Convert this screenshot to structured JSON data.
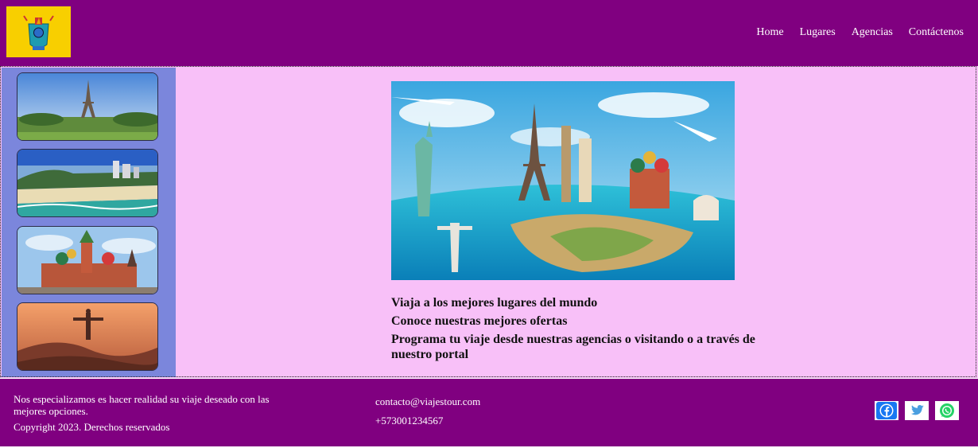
{
  "nav": {
    "items": [
      "Home",
      "Lugares",
      "Agencias",
      "Contáctenos"
    ]
  },
  "sidebar": {
    "thumbnails": [
      "eiffel-tower",
      "beach-city",
      "kremlin-cathedral",
      "christ-the-redeemer"
    ]
  },
  "main": {
    "lines": [
      "Viaja a los mejores lugares del mundo",
      "Conoce nuestras mejores ofertas",
      "Programa tu viaje desde nuestras agencias o visitando o a través de nuestro portal"
    ]
  },
  "footer": {
    "description": "Nos especializamos es hacer realidad su viaje deseado con las mejores opciones.",
    "copyright": "Copyright 2023. Derechos reservados",
    "email": "contacto@viajestour.com",
    "phone": "+573001234567",
    "social": [
      "facebook-icon",
      "twitter-icon",
      "whatsapp-icon"
    ]
  },
  "colors": {
    "header": "#800080",
    "main_bg": "#f8c0f8",
    "sidebar_bg": "#7b86dc",
    "logo_bg": "#f8cf00"
  }
}
